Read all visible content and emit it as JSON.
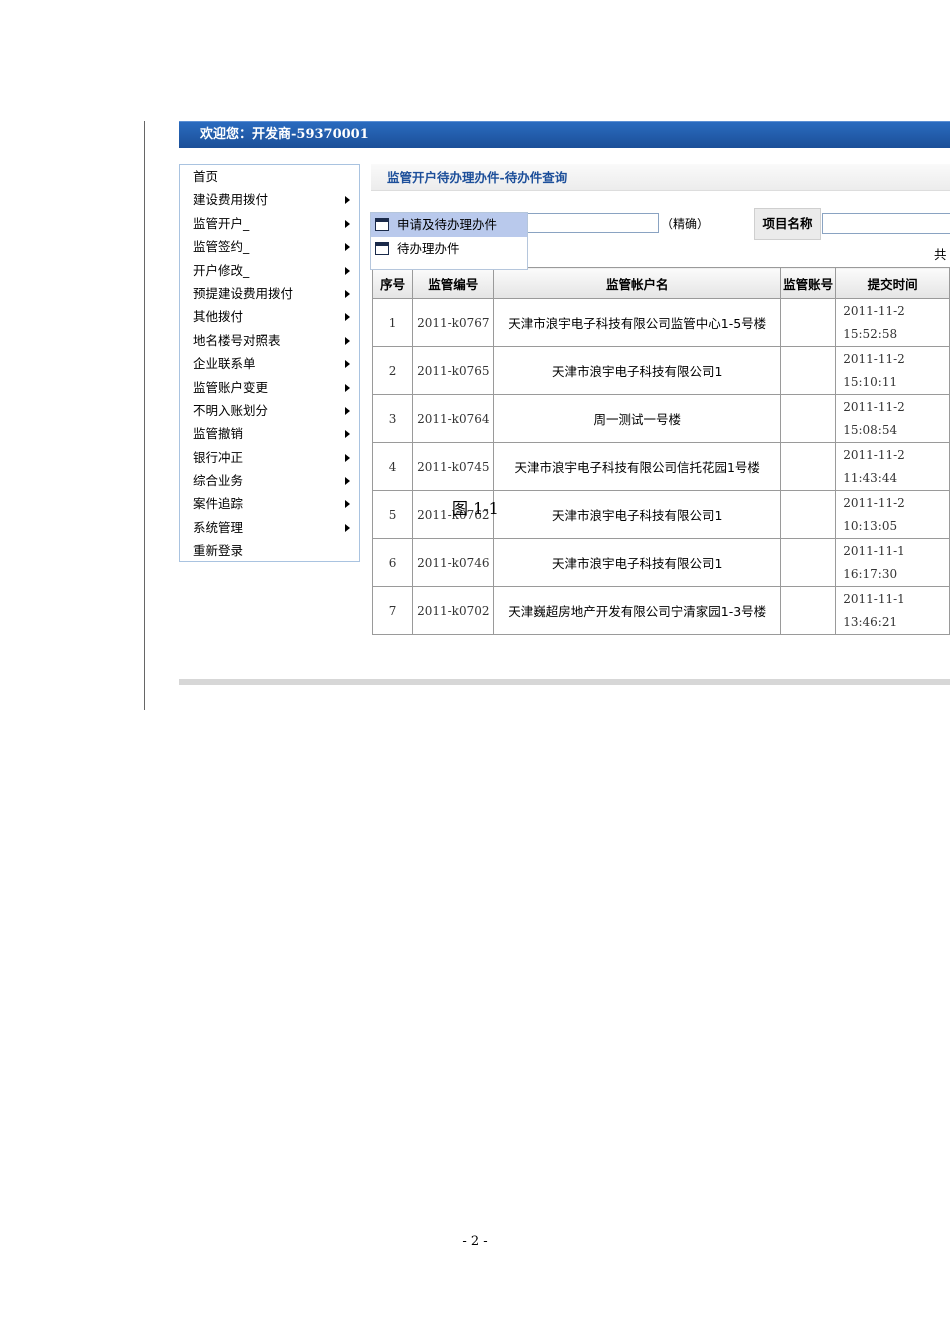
{
  "header": {
    "welcome": "欢迎您：开发商-59370001"
  },
  "sidebar": {
    "items": [
      {
        "label": "首页"
      },
      {
        "label": "建设费用拨付"
      },
      {
        "label": "监管开户_"
      },
      {
        "label": "监管签约_"
      },
      {
        "label": "开户修改_"
      },
      {
        "label": "预提建设费用拨付"
      },
      {
        "label": "其他拨付"
      },
      {
        "label": "地名楼号对照表"
      },
      {
        "label": "企业联系单"
      },
      {
        "label": "监管账户变更"
      },
      {
        "label": "不明入账划分"
      },
      {
        "label": "监管撤销"
      },
      {
        "label": "银行冲正"
      },
      {
        "label": "综合业务"
      },
      {
        "label": "案件追踪"
      },
      {
        "label": "系统管理"
      },
      {
        "label": "重新登录"
      }
    ]
  },
  "main": {
    "title": "监管开户待办理办件-待办件查询",
    "precise_label": "（精确）",
    "project_name_label": "项目名称",
    "total_label": "共"
  },
  "dropdown": {
    "items": [
      {
        "label": "申请及待办理办件",
        "active": true
      },
      {
        "label": "待办理办件",
        "active": false
      }
    ]
  },
  "table": {
    "headers": [
      "序号",
      "监管编号",
      "监管帐户名",
      "监管账号",
      "提交时间"
    ],
    "rows": [
      {
        "seq": "1",
        "code": "2011-k0767",
        "name": "天津市浪宇电子科技有限公司监管中心1-5号楼",
        "account": "",
        "date": "2011-11-2",
        "time": "15:52:58"
      },
      {
        "seq": "2",
        "code": "2011-k0765",
        "name": "天津市浪宇电子科技有限公司1",
        "account": "",
        "date": "2011-11-2",
        "time": "15:10:11"
      },
      {
        "seq": "3",
        "code": "2011-k0764",
        "name": "周一测试一号楼",
        "account": "",
        "date": "2011-11-2",
        "time": "15:08:54"
      },
      {
        "seq": "4",
        "code": "2011-k0745",
        "name": "天津市浪宇电子科技有限公司信托花园1号楼",
        "account": "",
        "date": "2011-11-2",
        "time": "11:43:44"
      },
      {
        "seq": "5",
        "code": "2011-k0762",
        "name": "天津市浪宇电子科技有限公司1",
        "account": "",
        "date": "2011-11-2",
        "time": "10:13:05"
      },
      {
        "seq": "6",
        "code": "2011-k0746",
        "name": "天津市浪宇电子科技有限公司1",
        "account": "",
        "date": "2011-11-1",
        "time": "16:17:30"
      },
      {
        "seq": "7",
        "code": "2011-k0702",
        "name": "天津巍超房地产开发有限公司宁清家园1-3号楼",
        "account": "",
        "date": "2011-11-1",
        "time": "13:46:21"
      }
    ]
  },
  "caption": "图 1-1",
  "page_number": "- 2 -"
}
